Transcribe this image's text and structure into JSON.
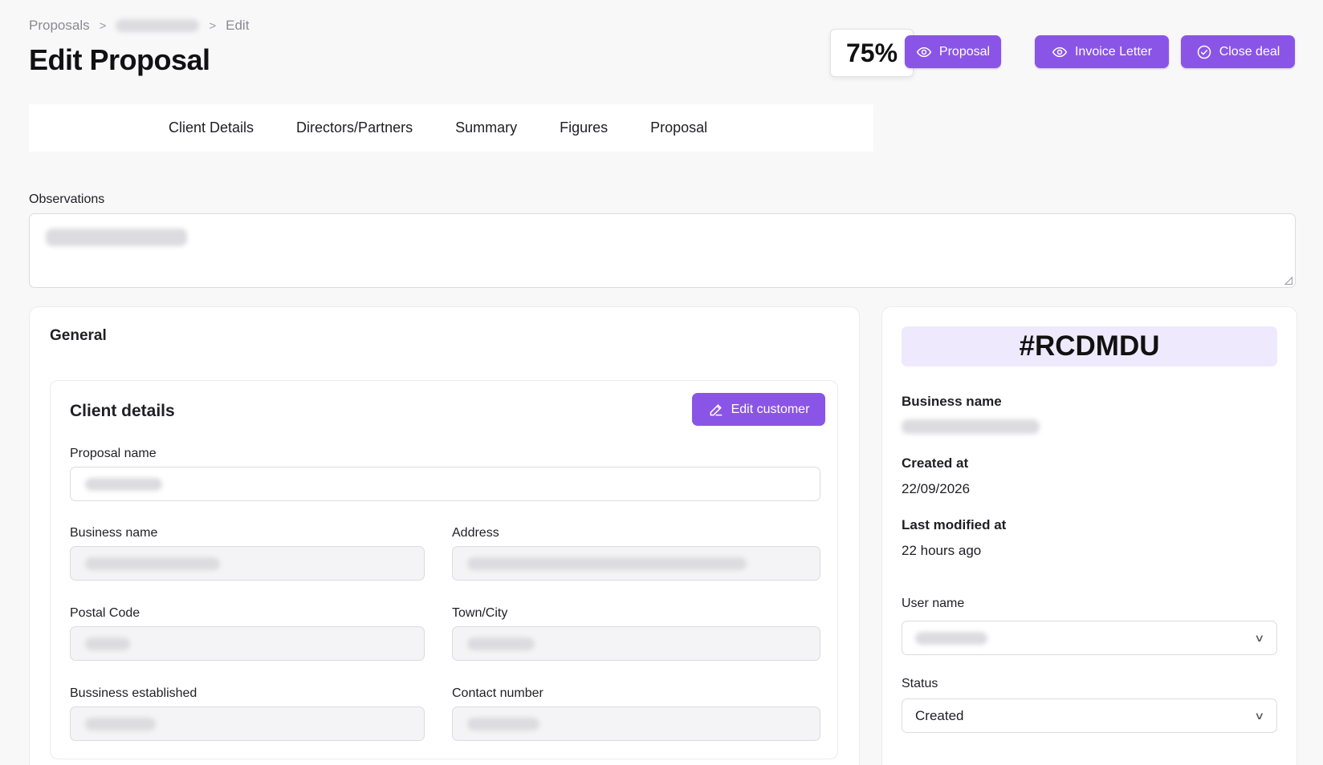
{
  "breadcrumb": {
    "root": "Proposals",
    "separator": ">",
    "current": "Edit"
  },
  "page": {
    "title": "Edit Proposal",
    "completion": "75%"
  },
  "actions": {
    "proposal_label": "Proposal",
    "invoice_label": "Invoice Letter",
    "close_label": "Close deal"
  },
  "tabs": [
    "Client Details",
    "Directors/Partners",
    "Summary",
    "Figures",
    "Proposal"
  ],
  "observations": {
    "label": "Observations"
  },
  "general": {
    "title": "General",
    "client_details": {
      "title": "Client details",
      "edit_label": "Edit customer",
      "fields": {
        "proposal_name": "Proposal name",
        "business_name": "Business name",
        "address": "Address",
        "postal_code": "Postal Code",
        "town_city": "Town/City",
        "established": "Bussiness established",
        "contact_number": "Contact number"
      }
    }
  },
  "side": {
    "code": "#RCDMDU",
    "business_name_label": "Business name",
    "created_label": "Created at",
    "created_value": "22/09/2026",
    "modified_label": "Last modified at",
    "modified_value": "22 hours ago",
    "user_label": "User name",
    "status_label": "Status",
    "status_value": "Created"
  },
  "colors": {
    "accent": "#8a55e6",
    "code_bg": "#efe9fd",
    "background": "#f8f8f9"
  },
  "icons": {
    "eye": "eye-icon",
    "check_circle": "check-circle-icon",
    "pencil": "pencil-icon",
    "chevron": "chevron-down-icon"
  }
}
